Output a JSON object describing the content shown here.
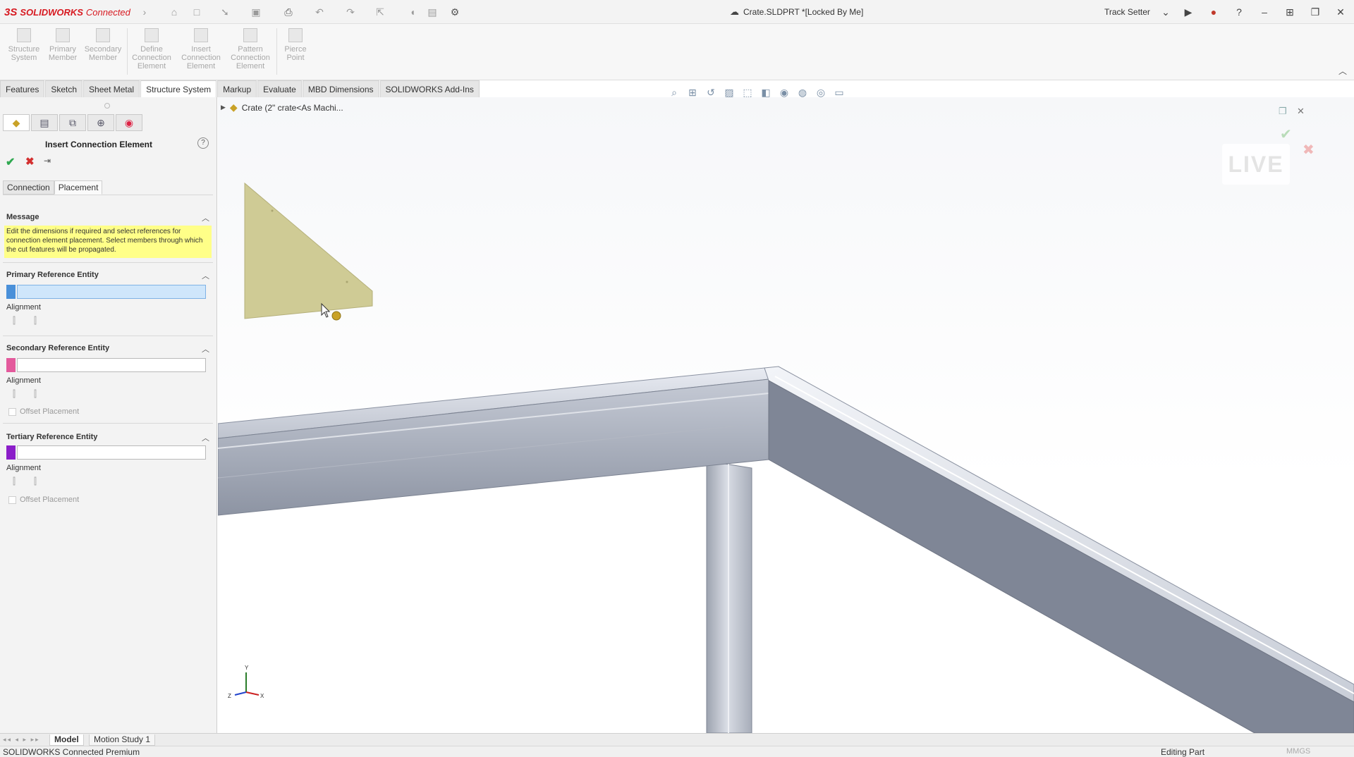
{
  "app": {
    "brand_prefix": "SOLIDWORKS",
    "brand_suffix": "Connected",
    "document_title": "Crate.SLDPRT *[Locked By Me]",
    "user_name": "Track Setter"
  },
  "command_manager": {
    "buttons": [
      {
        "label": "Structure System"
      },
      {
        "label": "Primary Member"
      },
      {
        "label": "Secondary Member"
      },
      {
        "label": "Define Connection Element"
      },
      {
        "label": "Insert Connection Element"
      },
      {
        "label": "Pattern Connection Element"
      },
      {
        "label": "Pierce Point"
      }
    ]
  },
  "tabs": [
    "Features",
    "Sketch",
    "Sheet Metal",
    "Structure System",
    "Markup",
    "Evaluate",
    "MBD Dimensions",
    "SOLIDWORKS Add-Ins"
  ],
  "active_tab": "Structure System",
  "property_manager": {
    "title": "Insert Connection Element",
    "sub_tabs": [
      "Connection",
      "Placement"
    ],
    "active_sub_tab": "Placement",
    "message_header": "Message",
    "message_text": "Edit the dimensions if required and select references for connection element placement. Select members through which the cut features will be propagated.",
    "primary_header": "Primary Reference Entity",
    "secondary_header": "Secondary Reference Entity",
    "tertiary_header": "Tertiary Reference Entity",
    "alignment_label": "Alignment",
    "offset_label": "Offset Placement",
    "primary_color": "#4a90d9",
    "secondary_color": "#e35a9c",
    "tertiary_color": "#8b1ec9"
  },
  "feature_tree": {
    "node_label": "Crate (2\" crate<As Machi..."
  },
  "viewport": {
    "live_badge": "LIVE",
    "gusset_color": "#cfcb95",
    "tube_color": "#9fa6b4"
  },
  "bottom_tabs": [
    "Model",
    "Motion Study 1"
  ],
  "active_bottom_tab": "Model",
  "status": {
    "left": "SOLIDWORKS Connected Premium",
    "editing": "Editing Part",
    "units": "MMGS"
  },
  "icons": {
    "home": "home-icon",
    "new": "new-document-icon",
    "open": "open-icon",
    "save": "save-icon",
    "print": "print-icon",
    "undo": "undo-icon",
    "redo": "redo-icon",
    "select": "select-icon",
    "rebuild": "rebuild-icon",
    "file-props": "file-properties-icon",
    "options": "gear-icon"
  }
}
